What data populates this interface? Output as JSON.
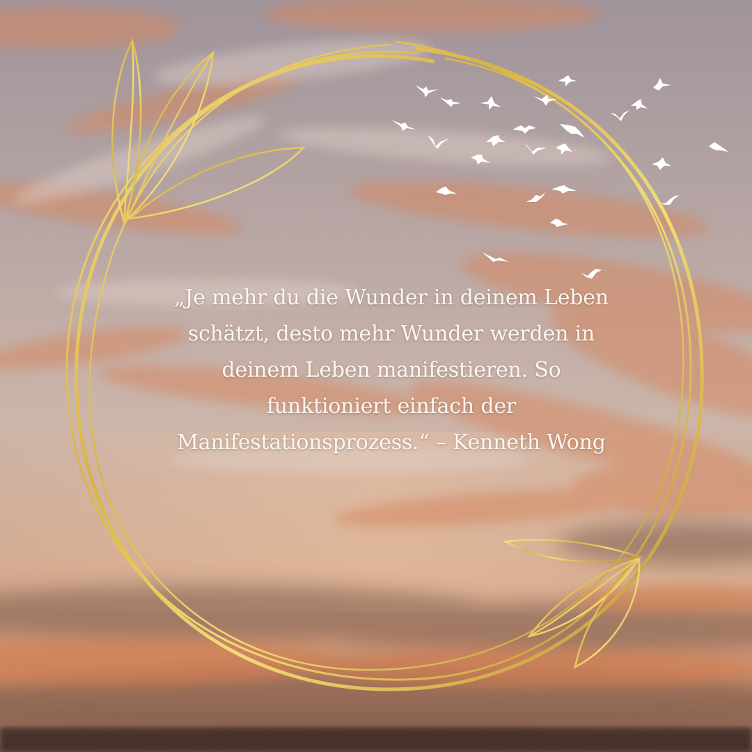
{
  "quote": {
    "lines": [
      "„Je mehr du die Wunder in deinem Leben",
      "schätzt, desto mehr Wunder werden in",
      "deinem Leben manifestieren. So",
      "funktioniert einfach der",
      "Manifestationsprozess.“ – Kenneth Wong"
    ]
  },
  "colors": {
    "sky_top": "#9d9299",
    "sky_mid": "#c9b3a9",
    "sky_low": "#d8a283",
    "cloud_orange": "#d9835a",
    "cloud_dark": "#6e5148",
    "gold_light": "#f4de7a",
    "gold_dark": "#b98f2a",
    "text": "#fbf6f1",
    "birds": "#ffffff"
  },
  "decorations": {
    "frame": "gold-wreath",
    "leaves": "gold-leaf-sprigs",
    "birds": "flock-of-birds"
  }
}
